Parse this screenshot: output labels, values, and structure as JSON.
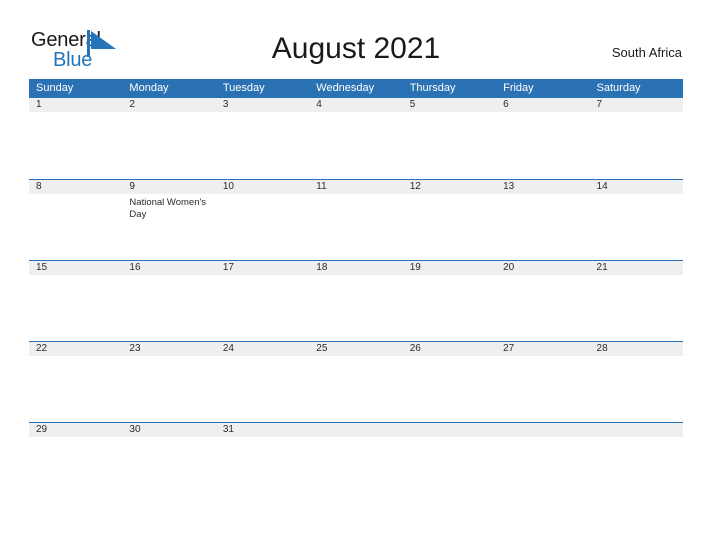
{
  "brand": {
    "word_one": "General",
    "word_two": "Blue",
    "mark_icon": "triangle-flag-icon",
    "color_black": "#1a1a1a",
    "color_blue": "#2576b8"
  },
  "header": {
    "title": "August 2021",
    "locale": "South Africa"
  },
  "theme": {
    "header_blue": "#2b72b5",
    "band_gray": "#efefef",
    "rule_blue": "#2b72b5",
    "text": "#2b2b2b",
    "page_background": "#ffffff"
  },
  "calendar": {
    "month": "August",
    "year": "2021",
    "weekday_headers": [
      "Sunday",
      "Monday",
      "Tuesday",
      "Wednesday",
      "Thursday",
      "Friday",
      "Saturday"
    ],
    "weeks": [
      {
        "days": [
          {
            "number": "1",
            "event": ""
          },
          {
            "number": "2",
            "event": ""
          },
          {
            "number": "3",
            "event": ""
          },
          {
            "number": "4",
            "event": ""
          },
          {
            "number": "5",
            "event": ""
          },
          {
            "number": "6",
            "event": ""
          },
          {
            "number": "7",
            "event": ""
          }
        ]
      },
      {
        "days": [
          {
            "number": "8",
            "event": ""
          },
          {
            "number": "9",
            "event": "National Women's Day"
          },
          {
            "number": "10",
            "event": ""
          },
          {
            "number": "11",
            "event": ""
          },
          {
            "number": "12",
            "event": ""
          },
          {
            "number": "13",
            "event": ""
          },
          {
            "number": "14",
            "event": ""
          }
        ]
      },
      {
        "days": [
          {
            "number": "15",
            "event": ""
          },
          {
            "number": "16",
            "event": ""
          },
          {
            "number": "17",
            "event": ""
          },
          {
            "number": "18",
            "event": ""
          },
          {
            "number": "19",
            "event": ""
          },
          {
            "number": "20",
            "event": ""
          },
          {
            "number": "21",
            "event": ""
          }
        ]
      },
      {
        "days": [
          {
            "number": "22",
            "event": ""
          },
          {
            "number": "23",
            "event": ""
          },
          {
            "number": "24",
            "event": ""
          },
          {
            "number": "25",
            "event": ""
          },
          {
            "number": "26",
            "event": ""
          },
          {
            "number": "27",
            "event": ""
          },
          {
            "number": "28",
            "event": ""
          }
        ]
      },
      {
        "days": [
          {
            "number": "29",
            "event": ""
          },
          {
            "number": "30",
            "event": ""
          },
          {
            "number": "31",
            "event": ""
          },
          {
            "number": "",
            "event": ""
          },
          {
            "number": "",
            "event": ""
          },
          {
            "number": "",
            "event": ""
          },
          {
            "number": "",
            "event": ""
          }
        ]
      }
    ]
  }
}
